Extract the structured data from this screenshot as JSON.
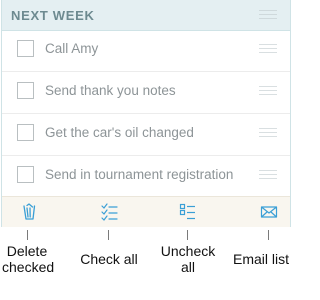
{
  "section": {
    "title": "NEXT WEEK"
  },
  "tasks": [
    {
      "label": "Call Amy",
      "checked": false
    },
    {
      "label": "Send thank you notes",
      "checked": false
    },
    {
      "label": "Get the car's oil changed",
      "checked": false
    },
    {
      "label": "Send in tournament registration",
      "checked": false
    }
  ],
  "toolbar": {
    "delete_icon": "trash-icon",
    "check_all_icon": "checklist-checked-icon",
    "uncheck_all_icon": "checklist-unchecked-icon",
    "email_icon": "envelope-icon",
    "icon_color": "#3a9fd6"
  },
  "callouts": {
    "delete_line1": "Delete",
    "delete_line2": "checked",
    "check_all": "Check all",
    "uncheck_line1": "Uncheck",
    "uncheck_line2": "all",
    "email_list": "Email list"
  }
}
